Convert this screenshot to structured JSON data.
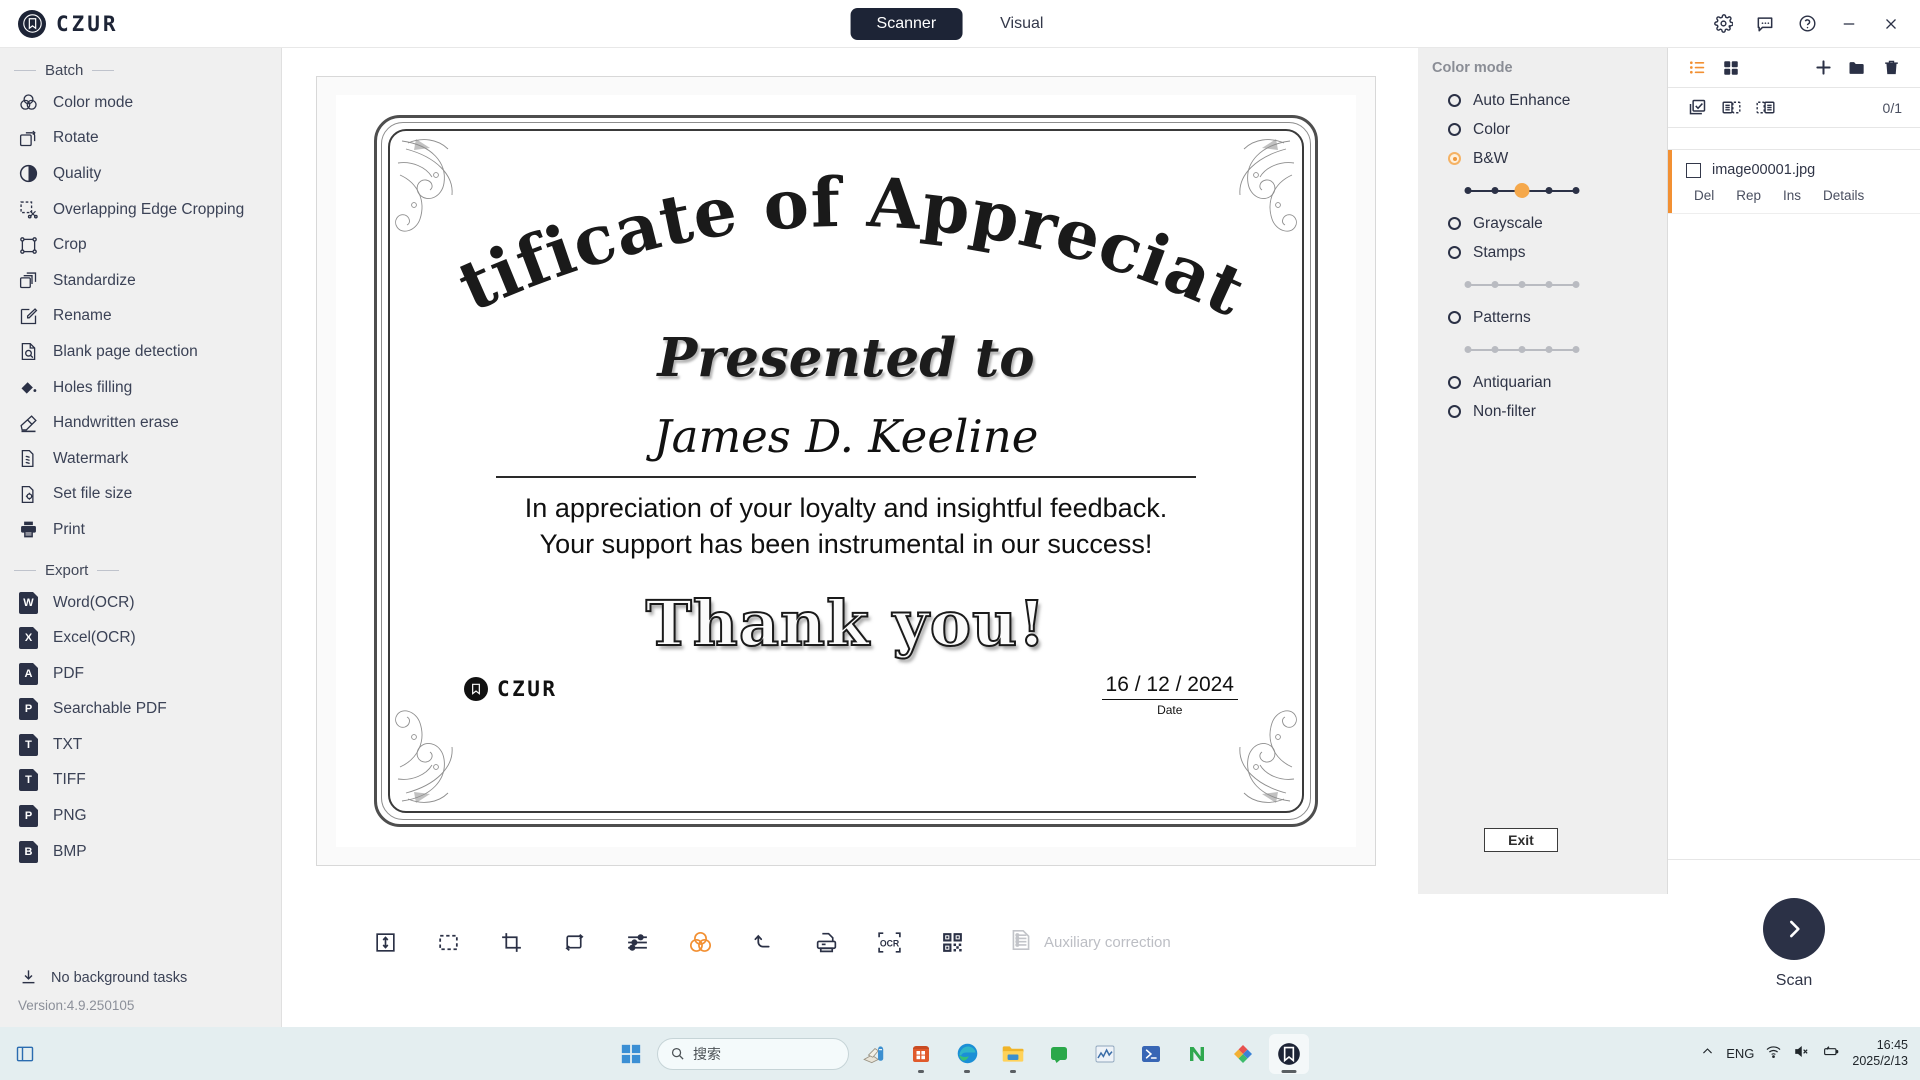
{
  "titlebar": {
    "brand_name": "CZUR",
    "tabs": [
      {
        "label": "Scanner",
        "active": true
      },
      {
        "label": "Visual",
        "active": false
      }
    ],
    "controls": [
      {
        "name": "settings-icon"
      },
      {
        "name": "feedback-icon"
      },
      {
        "name": "help-icon"
      },
      {
        "name": "minimize-icon"
      },
      {
        "name": "close-icon"
      }
    ]
  },
  "sidebar": {
    "sections": [
      {
        "title": "Batch",
        "items": [
          {
            "label": "Color mode",
            "icon": "color-mode-icon"
          },
          {
            "label": "Rotate",
            "icon": "rotate-icon"
          },
          {
            "label": "Quality",
            "icon": "quality-icon"
          },
          {
            "label": "Overlapping Edge Cropping",
            "icon": "overlap-crop-icon"
          },
          {
            "label": "Crop",
            "icon": "crop-icon"
          },
          {
            "label": "Standardize",
            "icon": "standardize-icon"
          },
          {
            "label": "Rename",
            "icon": "rename-icon"
          },
          {
            "label": "Blank page detection",
            "icon": "blank-page-icon"
          },
          {
            "label": "Holes filling",
            "icon": "holes-filling-icon"
          },
          {
            "label": "Handwritten erase",
            "icon": "handwritten-erase-icon"
          },
          {
            "label": "Watermark",
            "icon": "watermark-icon"
          },
          {
            "label": "Set file size",
            "icon": "file-size-icon"
          },
          {
            "label": "Print",
            "icon": "print-icon"
          }
        ]
      },
      {
        "title": "Export",
        "items": [
          {
            "label": "Word(OCR)",
            "icon": "word-icon",
            "badge": "W"
          },
          {
            "label": "Excel(OCR)",
            "icon": "excel-icon",
            "badge": "X"
          },
          {
            "label": "PDF",
            "icon": "pdf-icon",
            "badge": "A"
          },
          {
            "label": "Searchable PDF",
            "icon": "searchable-pdf-icon",
            "badge": "P"
          },
          {
            "label": "TXT",
            "icon": "txt-icon",
            "badge": "T"
          },
          {
            "label": "TIFF",
            "icon": "tiff-icon",
            "badge": "T"
          },
          {
            "label": "PNG",
            "icon": "png-icon",
            "badge": "P"
          },
          {
            "label": "BMP",
            "icon": "bmp-icon",
            "badge": "B"
          }
        ]
      }
    ],
    "footer": {
      "task_status": "No background tasks",
      "version": "Version:4.9.250105"
    }
  },
  "document": {
    "title": "Certificate of Appreciation",
    "presented_to": "Presented to",
    "recipient": "James D. Keeline",
    "body_line1": "In appreciation of your loyalty and insightful feedback.",
    "body_line2": "Your support has been instrumental in our success!",
    "thanks": "Thank you!",
    "logo_text": "CZUR",
    "date_value": "16 / 12 / 2024",
    "date_label": "Date"
  },
  "toolbar": {
    "tools": [
      {
        "name": "fit-height-icon",
        "accent": false
      },
      {
        "name": "select-area-icon",
        "accent": false
      },
      {
        "name": "crop-icon",
        "accent": false
      },
      {
        "name": "rotate-icon",
        "accent": false
      },
      {
        "name": "adjust-sliders-icon",
        "accent": false
      },
      {
        "name": "color-mode-icon",
        "accent": true
      },
      {
        "name": "undo-icon",
        "accent": false
      },
      {
        "name": "print-icon",
        "accent": false
      },
      {
        "name": "ocr-icon",
        "accent": false
      },
      {
        "name": "qrcode-icon",
        "accent": false
      }
    ],
    "auxiliary_label": "Auxiliary correction"
  },
  "color_mode_panel": {
    "title": "Color mode",
    "options": [
      {
        "label": "Auto Enhance",
        "selected": false,
        "slider": null
      },
      {
        "label": "Color",
        "selected": false,
        "slider": null
      },
      {
        "label": "B&W",
        "selected": true,
        "slider": {
          "steps": 5,
          "value": 3,
          "enabled": true
        }
      },
      {
        "label": "Grayscale",
        "selected": false,
        "slider": null
      },
      {
        "label": "Stamps",
        "selected": false,
        "slider": {
          "steps": 5,
          "value": 0,
          "enabled": false
        }
      },
      {
        "label": "Patterns",
        "selected": false,
        "slider": {
          "steps": 5,
          "value": 0,
          "enabled": false
        }
      },
      {
        "label": "Antiquarian",
        "selected": false,
        "slider": null
      },
      {
        "label": "Non-filter",
        "selected": false,
        "slider": null
      }
    ],
    "exit_label": "Exit",
    "accent_color": "#f0983c"
  },
  "file_panel": {
    "view_icons": [
      {
        "name": "list-view-icon",
        "accent": true
      },
      {
        "name": "grid-view-icon",
        "accent": false
      }
    ],
    "action_icons": [
      {
        "name": "add-icon",
        "accent": false
      },
      {
        "name": "folder-icon",
        "accent": false
      },
      {
        "name": "delete-icon",
        "accent": false
      }
    ],
    "select_icons": [
      {
        "name": "select-all-icon"
      },
      {
        "name": "select-odd-icon"
      },
      {
        "name": "select-even-icon"
      }
    ],
    "count": "0/1",
    "files": [
      {
        "name": "image00001.jpg",
        "checked": false,
        "actions": [
          "Del",
          "Rep",
          "Ins",
          "Details"
        ]
      }
    ],
    "scan_label": "Scan"
  },
  "taskbar": {
    "search_placeholder": "搜索",
    "apps": [
      {
        "name": "start-icon"
      },
      {
        "name": "snipping-tool-icon"
      },
      {
        "name": "microsoft-store-icon"
      },
      {
        "name": "edge-icon"
      },
      {
        "name": "file-explorer-icon"
      },
      {
        "name": "teams-icon"
      },
      {
        "name": "chart-app-icon"
      },
      {
        "name": "powershell-icon"
      },
      {
        "name": "n-app-icon"
      },
      {
        "name": "colorful-app-icon"
      },
      {
        "name": "czur-app-icon"
      }
    ],
    "tray": {
      "language": "ENG",
      "time": "16:45",
      "date": "2025/2/13",
      "icons": [
        "chevron-up-icon",
        "wifi-icon",
        "volume-muted-icon",
        "battery-icon"
      ]
    }
  }
}
